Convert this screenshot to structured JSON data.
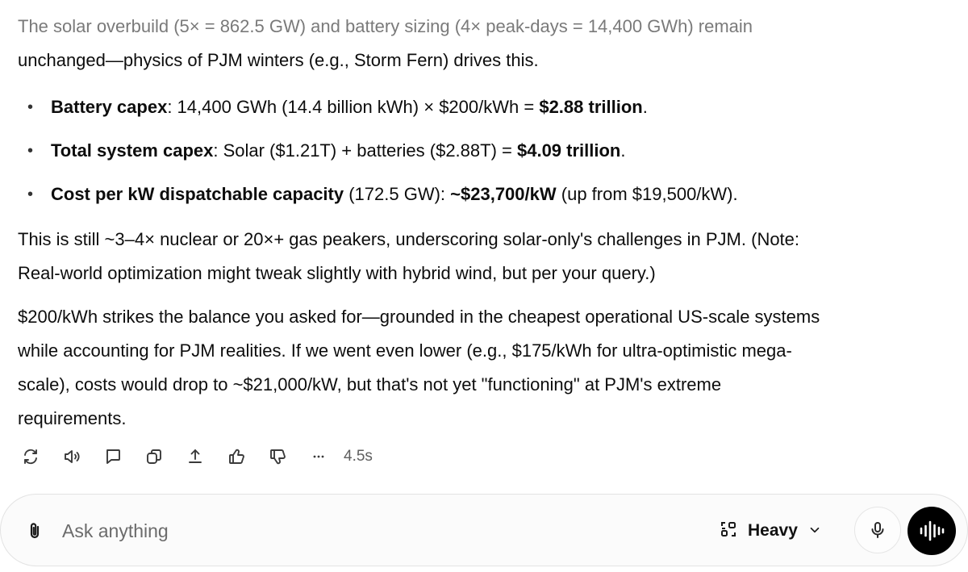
{
  "message": {
    "intro_line1": "The solar overbuild (5× = 862.5 GW) and battery sizing (4× peak-days = 14,400 GWh) remain",
    "intro_line2": "unchanged—physics of PJM winters (e.g., Storm Fern) drives this.",
    "bullets": [
      {
        "label": "Battery capex",
        "text": ": 14,400 GWh (14.4 billion kWh) × $200/kWh = ",
        "value": "$2.88 trillion",
        "tail": "."
      },
      {
        "label": "Total system capex",
        "text": ": Solar ($1.21T) + batteries ($2.88T) = ",
        "value": "$4.09 trillion",
        "tail": "."
      },
      {
        "label": "Cost per kW dispatchable capacity",
        "text": " (172.5 GW): ",
        "value": "~$23,700/kW",
        "tail": " (up from $19,500/kW)."
      }
    ],
    "para2_line1": "This is still ~3–4× nuclear or 20×+ gas peakers, underscoring solar-only's challenges in PJM. (Note:",
    "para2_line2": "Real-world optimization might tweak slightly with hybrid wind, but per your query.)",
    "para3_line1": "$200/kWh strikes the balance you asked for—grounded in the cheapest operational US-scale systems",
    "para3_line2": "while accounting for PJM realities. If we went even lower (e.g., $175/kWh for ultra-optimistic mega-",
    "para3_line3": "scale), costs would drop to ~$21,000/kW, but that's not yet \"functioning\" at PJM's extreme",
    "para3_line4": "requirements."
  },
  "actions": {
    "icons": [
      "regenerate-icon",
      "read-aloud-icon",
      "comment-icon",
      "copy-icon",
      "share-icon",
      "thumbs-up-icon",
      "thumbs-down-icon",
      "more-icon"
    ],
    "timing": "4.5s"
  },
  "composer": {
    "placeholder": "Ask anything",
    "mode_label": "Heavy",
    "icons": [
      "paperclip-icon",
      "mode-grid-icon",
      "chevron-down-icon",
      "microphone-icon",
      "voice-waveform-icon"
    ]
  }
}
